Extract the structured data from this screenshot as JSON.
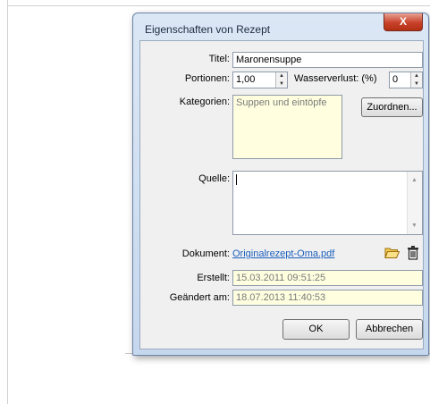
{
  "window": {
    "title": "Eigenschaften von Rezept",
    "close_glyph": "X"
  },
  "form": {
    "title_label": "Titel:",
    "title_value": "Maronensuppe",
    "portions_label": "Portionen:",
    "portions_value": "1,00",
    "water_loss_label": "Wasserverlust: (%)",
    "water_loss_value": "0",
    "categories_label": "Kategorien:",
    "categories_value": "Suppen und eintöpfe",
    "assign_button": "Zuordnen...",
    "source_label": "Quelle:",
    "source_value": "",
    "document_label": "Dokument:",
    "document_link": "Originalrezept-Oma.pdf",
    "created_label": "Erstellt:",
    "created_value": "15.03.2011 09:51:25",
    "modified_label": "Geändert am:",
    "modified_value": "18.07.2013 11:40:53"
  },
  "buttons": {
    "ok": "OK",
    "cancel": "Abbrechen"
  },
  "icons": {
    "folder": "folder-open-icon",
    "trash": "trash-icon"
  },
  "colors": {
    "readonly_bg": "#ffffe0",
    "link": "#1a5ebd",
    "close_red": "#c8412a"
  }
}
